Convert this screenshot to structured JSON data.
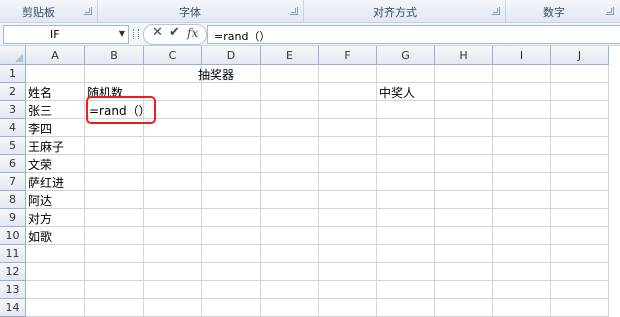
{
  "ribbon": {
    "groups": [
      "剪贴板",
      "字体",
      "对齐方式",
      "数字"
    ]
  },
  "formula_bar": {
    "name_box": "IF",
    "cancel_icon": "x-icon",
    "enter_icon": "check-icon",
    "fx_label": "fx",
    "content": "=rand（）"
  },
  "sheet": {
    "columns": [
      "A",
      "B",
      "C",
      "D",
      "E",
      "F",
      "G",
      "H",
      "I",
      "J"
    ],
    "rows": [
      "1",
      "2",
      "3",
      "4",
      "5",
      "6",
      "7",
      "8",
      "9",
      "10",
      "11",
      "12",
      "13",
      "14"
    ],
    "cells": {
      "title": "抽奖器",
      "a2": "姓名",
      "b2": "随机数",
      "g2": "中奖人",
      "names": [
        "张三",
        "李四",
        "王麻子",
        "文荣",
        "萨红进",
        "阿达",
        "对方",
        "如歌"
      ],
      "b3": "=rand（）"
    }
  },
  "colors": {
    "highlight": "#e8201a",
    "header_bg": "#e4e9f1",
    "gridline": "#d4d4d4"
  }
}
